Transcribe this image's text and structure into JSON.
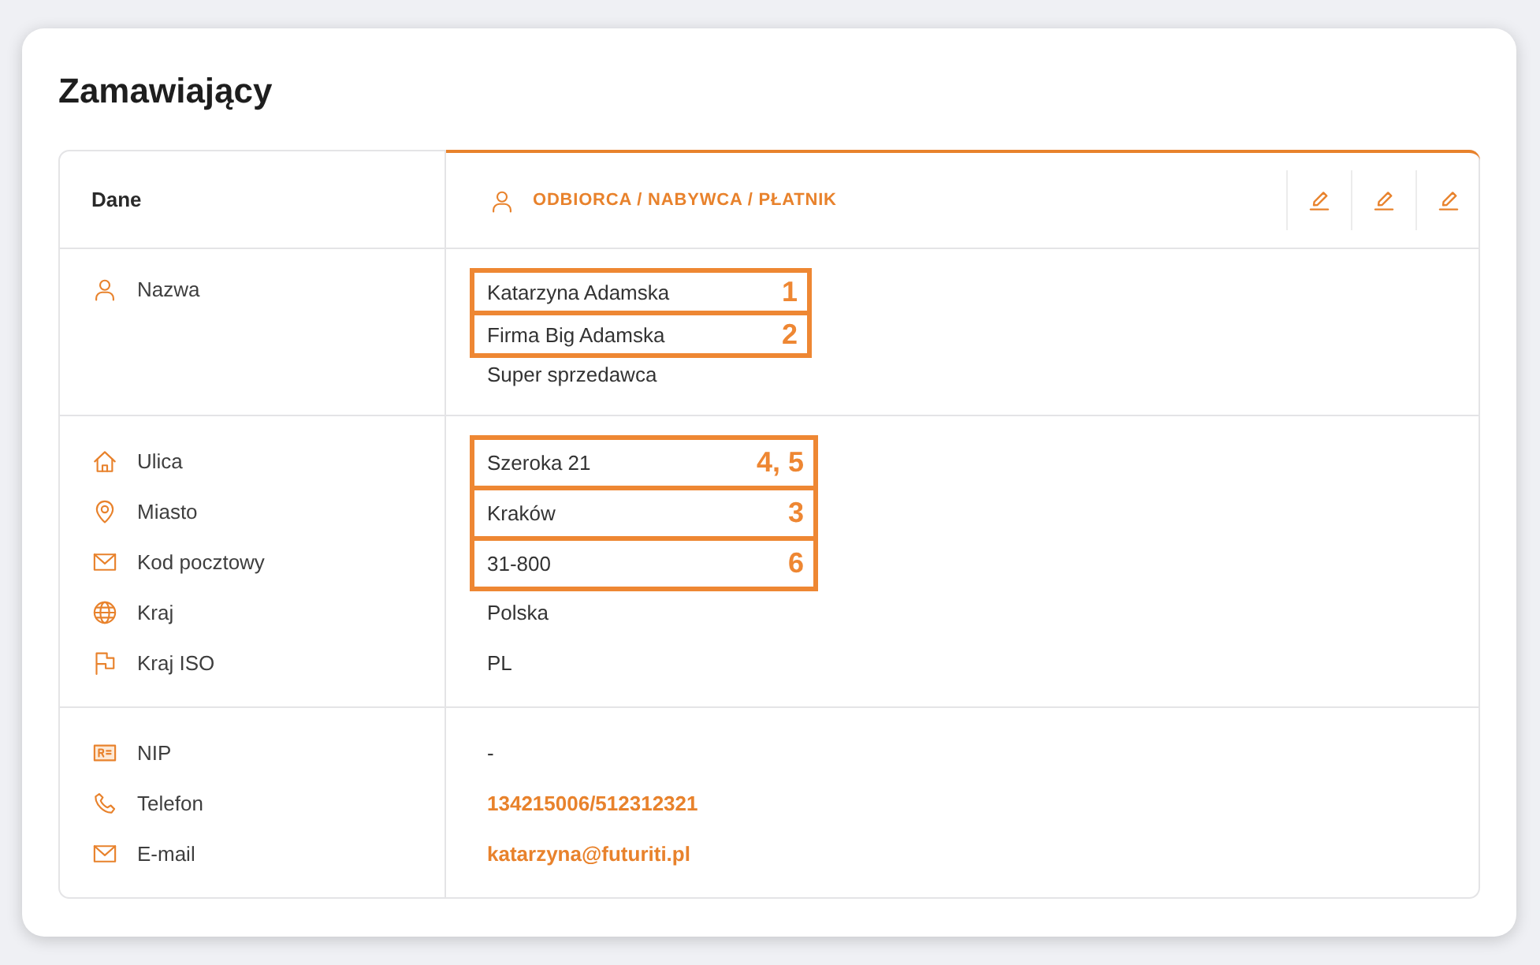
{
  "title": "Zamawiający",
  "table": {
    "header": {
      "label": "Dane",
      "party": {
        "label": "ODBIORCA / NABYWCA / PŁATNIK",
        "selected": true
      },
      "actions": [
        {
          "kind": "edit"
        },
        {
          "kind": "edit"
        },
        {
          "kind": "edit"
        }
      ]
    },
    "sections": [
      {
        "rows": [
          {
            "kind": "name",
            "label": "Nazwa",
            "values": [
              {
                "text": "Katarzyna Adamska",
                "callout": "1"
              },
              {
                "text": "Firma Big Adamska",
                "callout": "2"
              },
              {
                "text": "Super sprzedawca"
              }
            ]
          }
        ]
      },
      {
        "rows": [
          {
            "kind": "street",
            "label": "Ulica",
            "values": [
              {
                "text": "Szeroka 21",
                "callout": "4, 5"
              }
            ]
          },
          {
            "kind": "city",
            "label": "Miasto",
            "values": [
              {
                "text": "Kraków",
                "callout": "3"
              }
            ]
          },
          {
            "kind": "postal_code",
            "label": "Kod pocztowy",
            "values": [
              {
                "text": "31-800",
                "callout": "6"
              }
            ]
          },
          {
            "kind": "country",
            "label": "Kraj",
            "values": [
              {
                "text": "Polska"
              }
            ]
          },
          {
            "kind": "country_iso",
            "label": "Kraj ISO",
            "values": [
              {
                "text": "PL"
              }
            ]
          }
        ]
      },
      {
        "rows": [
          {
            "kind": "tax_id",
            "label": "NIP",
            "values": [
              {
                "text": "-"
              }
            ]
          },
          {
            "kind": "phone",
            "label": "Telefon",
            "values": [
              {
                "text": "134215006/512312321"
              }
            ]
          },
          {
            "kind": "email",
            "label": "E-mail",
            "values": [
              {
                "text": "katarzyna@futuriti.pl"
              }
            ]
          }
        ]
      }
    ]
  }
}
